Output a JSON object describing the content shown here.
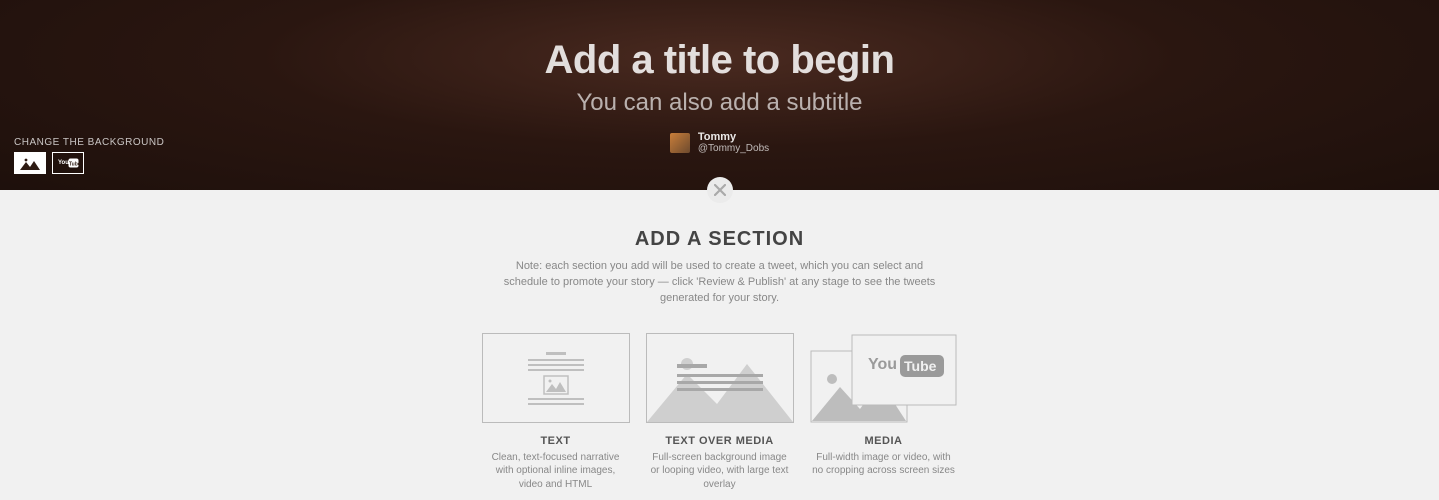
{
  "hero": {
    "title_placeholder": "Add a title to begin",
    "subtitle_placeholder": "You can also add a subtitle",
    "author_name": "Tommy",
    "author_handle": "@Tommy_Dobs",
    "bg_label": "CHANGE THE BACKGROUND"
  },
  "sectionPanel": {
    "heading": "ADD A SECTION",
    "note": "Note: each section you add will be used to create a tweet, which you can select and schedule to promote your story — click 'Review & Publish' at any stage to see the tweets generated for your story.",
    "options": [
      {
        "title": "TEXT",
        "desc": "Clean, text-focused narrative with optional inline images, video and HTML"
      },
      {
        "title": "TEXT OVER MEDIA",
        "desc": "Full-screen background image or looping video, with large text overlay"
      },
      {
        "title": "MEDIA",
        "desc": "Full-width image or video, with no cropping across screen sizes"
      }
    ]
  }
}
